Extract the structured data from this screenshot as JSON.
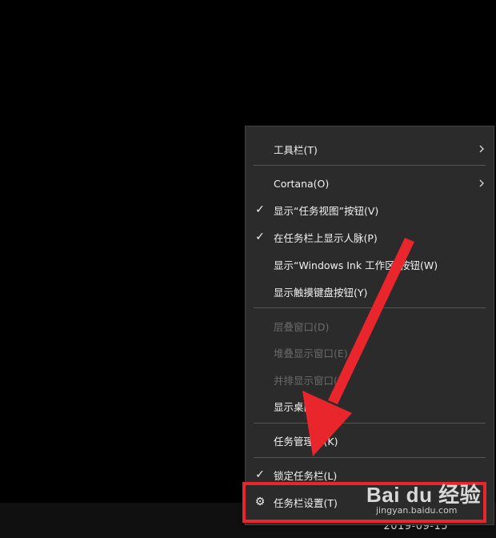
{
  "menu": {
    "toolbar": "工具栏(T)",
    "cortana": "Cortana(O)",
    "show_task_view": "显示“任务视图”按钮(V)",
    "show_people": "在任务栏上显示人脉(P)",
    "show_ink": "显示“Windows Ink 工作区”按钮(W)",
    "show_touch_keyboard": "显示触摸键盘按钮(Y)",
    "cascade": "层叠窗口(D)",
    "stack": "堆叠显示窗口(E)",
    "side_by_side": "并排显示窗口(I)",
    "show_desktop": "显示桌面(S)",
    "task_manager": "任务管理器(K)",
    "lock_taskbar": "锁定任务栏(L)",
    "taskbar_settings": "任务栏设置(T)"
  },
  "taskbar": {
    "date": "2019-09-15"
  },
  "watermark": {
    "logo": "Bai du 经验",
    "url": "jingyan.baidu.com"
  },
  "colors": {
    "menu_bg": "#2b2b2b",
    "annotation_red": "#e8262c"
  },
  "icons": {
    "check": "check-icon",
    "submenu": "chevron-right-icon",
    "settings": "gear-icon"
  }
}
